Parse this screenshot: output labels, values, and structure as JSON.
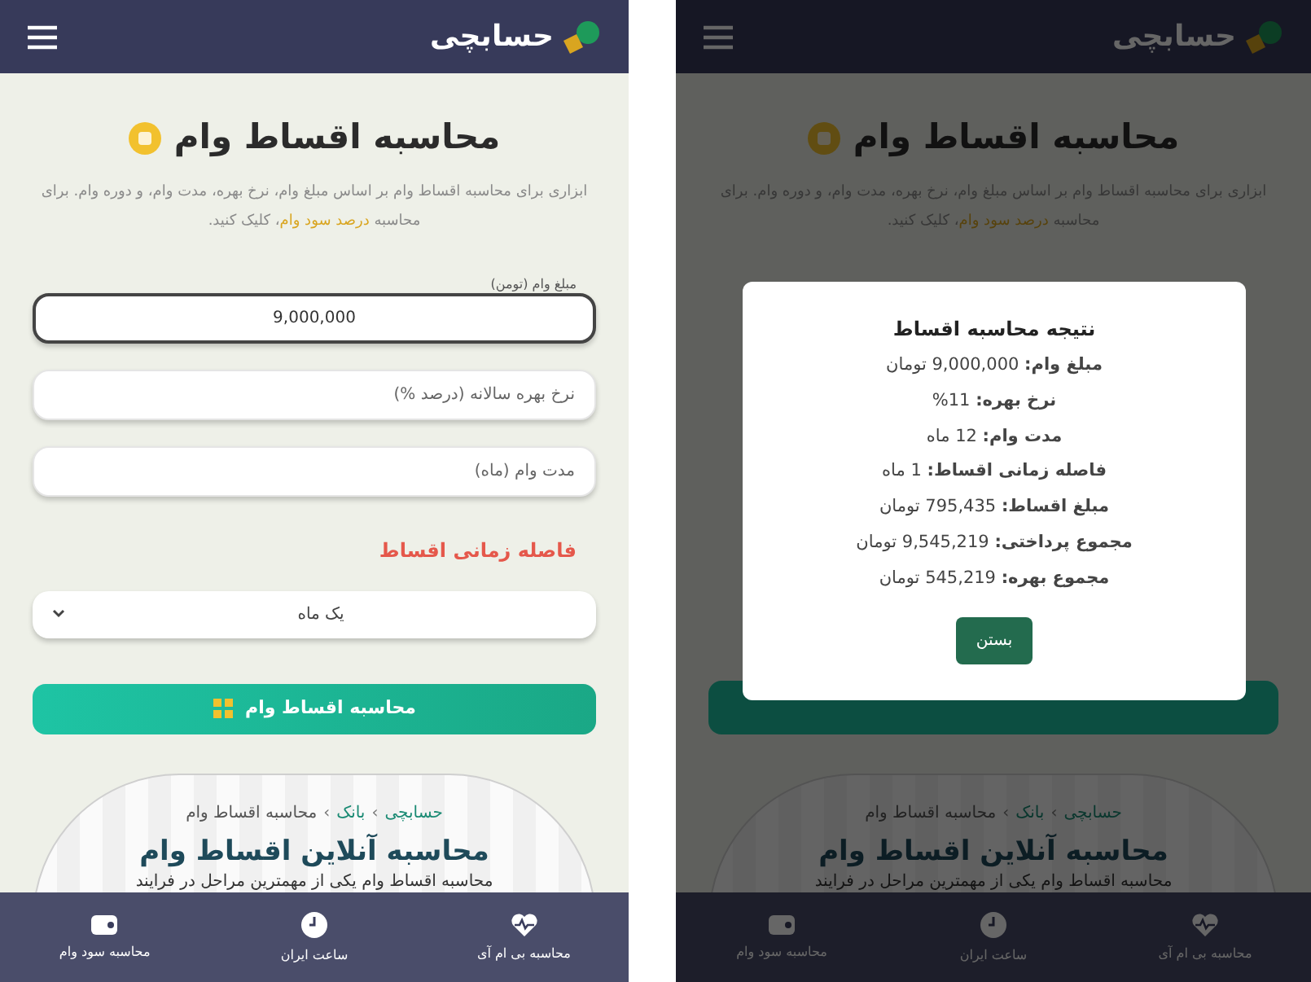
{
  "screens": [
    {
      "header": {
        "logo": "حسابچی"
      },
      "title": "محاسبه اقساط وام",
      "description": {
        "before": "ابزاری برای محاسبه اقساط وام بر اساس مبلغ وام، نرخ بهره، مدت وام، و دوره وام. برای محاسبه",
        "link": "درصد سود وام",
        "after": "، کلیک کنید."
      },
      "breadcrumb": [
        {
          "label": "حسابچی",
          "link": true
        },
        {
          "label": "›",
          "link": false,
          "kind": "separator"
        },
        {
          "label": "بانک",
          "link": true
        },
        {
          "label": "›",
          "link": false,
          "kind": "separator"
        },
        {
          "label": "محاسبه اقساط وام",
          "link": false
        }
      ],
      "section_heading": "محاسبه آنلاین اقساط وام",
      "section_text": "محاسبه اقساط وام یکی از مهمترین مراحل در فرایند",
      "bottom_nav": [
        {
          "label": "محاسبه بی ام آی",
          "kind": "heart"
        },
        {
          "label": "ساعت ایران",
          "kind": "clock"
        },
        {
          "label": "محاسبه سود وام",
          "kind": "wallet"
        }
      ],
      "modal": {
        "title": "نتیجه محاسبه اقساط",
        "rows": [
          "**مبلغ وام:** 9,000,000 تومان",
          "**نرخ بهره:** 11%",
          "**مدت وام:** 12 ماه",
          "**فاصله زمانی اقساط:** 1 ماه",
          "**مبلغ اقساط:** 795,435 تومان",
          "**مجموع پرداختی:** 9,545,219 تومان",
          "**مجموع بهره:** 545,219 تومان"
        ],
        "button": "بستن"
      }
    },
    {
      "header": {
        "logo": "حسابچی"
      },
      "title": "محاسبه اقساط وام",
      "description": {
        "before": "ابزاری برای محاسبه اقساط وام بر اساس مبلغ وام، نرخ بهره، مدت وام، و دوره وام. برای محاسبه",
        "link": "درصد سود وام",
        "after": "، کلیک کنید."
      },
      "form": {
        "fields": [
          {
            "label": "مبلغ وام (تومن)",
            "value": "9,000,000",
            "focused": true
          },
          {
            "placeholder": "نرخ بهره سالانه (درصد %)",
            "focused": false
          },
          {
            "placeholder": "مدت وام (ماه)",
            "focused": false
          }
        ],
        "interval_label": "فاصله زمانی اقساط",
        "select_value": "یک ماه",
        "button": "محاسبه اقساط وام"
      },
      "breadcrumb": [
        {
          "label": "حسابچی",
          "link": true
        },
        {
          "label": "›",
          "link": false,
          "kind": "separator"
        },
        {
          "label": "بانک",
          "link": true
        },
        {
          "label": "›",
          "link": false,
          "kind": "separator"
        },
        {
          "label": "محاسبه اقساط وام",
          "link": false
        }
      ],
      "section_heading": "محاسبه آنلاین اقساط وام",
      "section_text": "محاسبه اقساط وام یکی از مهمترین مراحل در فرایند",
      "bottom_nav": [
        {
          "label": "محاسبه بی ام آی",
          "kind": "heart"
        },
        {
          "label": "ساعت ایران",
          "kind": "clock"
        },
        {
          "label": "محاسبه سود وام",
          "kind": "wallet"
        }
      ]
    }
  ]
}
